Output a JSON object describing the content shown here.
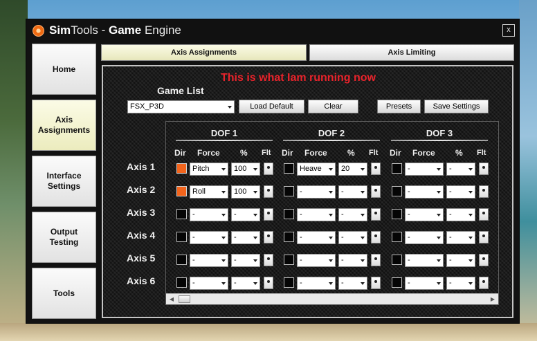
{
  "window": {
    "title_brand": "Sim",
    "title_brand_rest": "Tools",
    "title_sep": " - ",
    "title_game": "Game",
    "title_rest": " Engine",
    "close_label": "x"
  },
  "nav": [
    {
      "id": "home",
      "label": "Home"
    },
    {
      "id": "axis-assignments",
      "label": "Axis\nAssignments",
      "active": true
    },
    {
      "id": "interface-settings",
      "label": "Interface\nSettings"
    },
    {
      "id": "output-testing",
      "label": "Output\nTesting"
    },
    {
      "id": "tools",
      "label": "Tools"
    }
  ],
  "tabs": [
    {
      "id": "axis-assignments",
      "label": "Axis Assignments",
      "active": true
    },
    {
      "id": "axis-limiting",
      "label": "Axis Limiting"
    }
  ],
  "annotation": "This is what Iam running now",
  "game_list": {
    "label": "Game List",
    "selected": "FSX_P3D"
  },
  "buttons": {
    "load_default": "Load Default",
    "clear": "Clear",
    "presets": "Presets",
    "save_settings": "Save Settings"
  },
  "headers": {
    "dir": "Dir",
    "force": "Force",
    "percent": "%",
    "flt": "Flt"
  },
  "dofs": [
    {
      "title": "DOF 1",
      "rows": [
        {
          "dir": true,
          "force": "Pitch",
          "percent": "100"
        },
        {
          "dir": true,
          "force": "Roll",
          "percent": "100"
        },
        {
          "dir": false,
          "force": "-",
          "percent": "-"
        },
        {
          "dir": false,
          "force": "-",
          "percent": "-"
        },
        {
          "dir": false,
          "force": "-",
          "percent": "-"
        },
        {
          "dir": false,
          "force": "-",
          "percent": "-"
        }
      ]
    },
    {
      "title": "DOF 2",
      "rows": [
        {
          "dir": false,
          "force": "Heave",
          "percent": "20"
        },
        {
          "dir": false,
          "force": "-",
          "percent": "-"
        },
        {
          "dir": false,
          "force": "-",
          "percent": "-"
        },
        {
          "dir": false,
          "force": "-",
          "percent": "-"
        },
        {
          "dir": false,
          "force": "-",
          "percent": "-"
        },
        {
          "dir": false,
          "force": "-",
          "percent": "-"
        }
      ]
    },
    {
      "title": "DOF 3",
      "rows": [
        {
          "dir": false,
          "force": "-",
          "percent": "-"
        },
        {
          "dir": false,
          "force": "-",
          "percent": "-"
        },
        {
          "dir": false,
          "force": "-",
          "percent": "-"
        },
        {
          "dir": false,
          "force": "-",
          "percent": "-"
        },
        {
          "dir": false,
          "force": "-",
          "percent": "-"
        },
        {
          "dir": false,
          "force": "-",
          "percent": "-"
        }
      ]
    }
  ],
  "axes": [
    "Axis 1",
    "Axis 2",
    "Axis 3",
    "Axis 4",
    "Axis 5",
    "Axis 6"
  ],
  "icons": {
    "app": "simtools-logo-icon",
    "scroll_left": "scroll-left-icon",
    "scroll_right": "scroll-right-icon"
  },
  "colors": {
    "accent_orange": "#f2641c",
    "annotation_red": "#e8232b",
    "active_button": "#f4f4d2"
  }
}
